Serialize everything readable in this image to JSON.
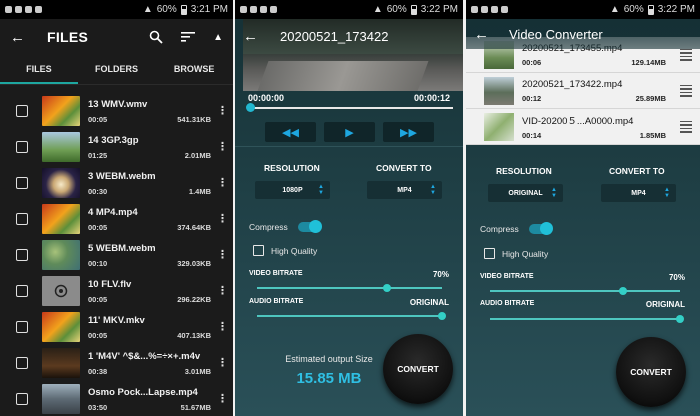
{
  "status": {
    "phone1": {
      "battery": "60%",
      "time": "3:21 PM"
    },
    "phone2": {
      "battery": "60%",
      "time": "3:22 PM"
    },
    "phone3": {
      "battery": "60%",
      "time": "3:22 PM"
    }
  },
  "files_screen": {
    "title": "FILES",
    "tabs": [
      {
        "label": "FILES",
        "active": true
      },
      {
        "label": "FOLDERS",
        "active": false
      },
      {
        "label": "BROWSE",
        "active": false
      }
    ],
    "files": [
      {
        "name": "13 WMV.wmv",
        "duration": "00:05",
        "size": "541.31KB"
      },
      {
        "name": "14 3GP.3gp",
        "duration": "01:25",
        "size": "2.01MB"
      },
      {
        "name": "3 WEBM.webm",
        "duration": "00:30",
        "size": "1.4MB"
      },
      {
        "name": "4 MP4.mp4",
        "duration": "00:05",
        "size": "374.64KB"
      },
      {
        "name": "5 WEBM.webm",
        "duration": "00:10",
        "size": "329.03KB"
      },
      {
        "name": "10 FLV.flv",
        "duration": "00:05",
        "size": "296.22KB"
      },
      {
        "name": "11' MKV.mkv",
        "duration": "00:05",
        "size": "407.13KB"
      },
      {
        "name": "1 'M4V' ^$&...%=÷×+.m4v",
        "duration": "00:38",
        "size": "3.01MB"
      },
      {
        "name": "Osmo Pock...Lapse.mp4",
        "duration": "03:50",
        "size": "51.67MB"
      }
    ]
  },
  "converter_screen": {
    "title": "20200521_173422",
    "time_current": "00:00:00",
    "time_total": "00:00:12",
    "resolution_label": "RESOLUTION",
    "resolution_value": "1080P",
    "convert_to_label": "CONVERT TO",
    "convert_to_value": "MP4",
    "compress_label": "Compress",
    "high_quality_label": "High Quality",
    "video_bitrate_label": "VIDEO BITRATE",
    "video_bitrate_value": "70%",
    "video_bitrate_fraction": 0.7,
    "audio_bitrate_label": "AUDIO BITRATE",
    "audio_bitrate_value": "ORIGINAL",
    "estimated_label": "Estimated output Size",
    "estimated_value": "15.85 MB",
    "convert_label": "CONVERT"
  },
  "batch_screen": {
    "title": "Video Converter",
    "queue": [
      {
        "name": "20200521_173455.mp4",
        "duration": "00:06",
        "size": "129.14MB"
      },
      {
        "name": "20200521_173422.mp4",
        "duration": "00:12",
        "size": "25.89MB"
      },
      {
        "name": "VID-20200５...A0000.mp4",
        "duration": "00:14",
        "size": "1.85MB"
      }
    ],
    "resolution_label": "RESOLUTION",
    "resolution_value": "ORIGINAL",
    "convert_to_label": "CONVERT TO",
    "convert_to_value": "MP4",
    "compress_label": "Compress",
    "high_quality_label": "High Quality",
    "video_bitrate_label": "VIDEO BITRATE",
    "video_bitrate_value": "70%",
    "video_bitrate_fraction": 0.7,
    "audio_bitrate_label": "AUDIO BITRATE",
    "audio_bitrate_value": "ORIGINAL",
    "convert_label": "CONVERT"
  },
  "colors": {
    "accent_teal": "#1ea7a0",
    "accent_blue": "#2fbfe3"
  }
}
